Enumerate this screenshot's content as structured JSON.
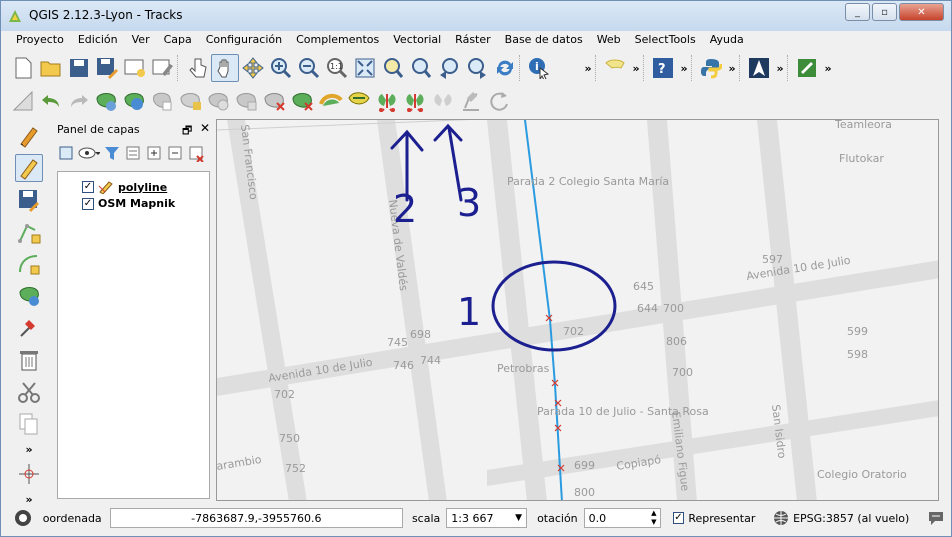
{
  "window": {
    "title": "QGIS 2.12.3-Lyon - Tracks"
  },
  "menus": [
    "Proyecto",
    "Edición",
    "Ver",
    "Capa",
    "Configuración",
    "Complementos",
    "Vectorial",
    "Ráster",
    "Base de datos",
    "Web",
    "SelectTools",
    "Ayuda"
  ],
  "overflow": "»",
  "panel": {
    "title": "Panel de capas",
    "layers": [
      {
        "name": "polyline",
        "checked": true
      },
      {
        "name": "OSM Mapnik",
        "checked": true
      }
    ]
  },
  "left_more": "»",
  "map": {
    "streets": [
      "San Francisco",
      "Nueva de Valdés",
      "Avenida 10 de Julio",
      "Avenida 10 de Julio",
      "Emiliano Figue",
      "San Isidro",
      "Copiapó",
      "arambio"
    ],
    "places": [
      "Parada 2 Colegio Santa María",
      "Petrobras",
      "Parada 10 de Julio - Santa Rosa",
      "Flutokar",
      "Teamleora",
      "Colegio Oratorio"
    ],
    "numbers": [
      "597",
      "645",
      "644",
      "700",
      "702",
      "806",
      "745",
      "746",
      "744",
      "698",
      "702",
      "700",
      "599",
      "598",
      "750",
      "699",
      "752",
      "800"
    ],
    "annotations": [
      "1",
      "2",
      "3"
    ]
  },
  "status": {
    "coord_label": "oordenada",
    "coord_value": "-7863687.9,-3955760.6",
    "scale_label": "scala",
    "scale_value": "1:3 667",
    "rotation_label": "otación",
    "rotation_value": "0.0",
    "render_label": "Representar",
    "render_checked": true,
    "crs": "EPSG:3857 (al vuelo)"
  },
  "colors": {
    "track": "#2b9be0",
    "annotation": "#1b1f8f",
    "vertex": "#d43a2f"
  }
}
